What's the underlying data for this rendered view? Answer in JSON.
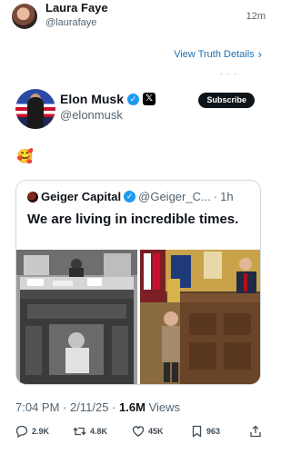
{
  "header": {
    "name": "Laura Faye",
    "handle": "@laurafaye",
    "time": "12m"
  },
  "view_link": {
    "label": "View Truth Details",
    "chevron": "›"
  },
  "profile": {
    "name": "Elon Musk",
    "handle": "@elonmusk",
    "subscribe_label": "Subscribe",
    "verified_glyph": "✓",
    "x_glyph": "𝕏"
  },
  "post": {
    "emoji": "🥰"
  },
  "quote": {
    "name": "Geiger Capital",
    "handle": "@Geiger_C...",
    "separator": "·",
    "time": "1h",
    "text": "We are living in incredible times.",
    "verified_glyph": "✓"
  },
  "stats": {
    "time": "7:04 PM",
    "dot": "·",
    "date": "2/11/25",
    "views_count": "1.6M",
    "views_label": "Views"
  },
  "actions": {
    "replies": "2.9K",
    "reposts": "4.8K",
    "likes": "45K",
    "bookmarks": "963"
  },
  "colors": {
    "accent": "#1d9bf0",
    "link": "#1d6fb0",
    "text_secondary": "#536471"
  }
}
